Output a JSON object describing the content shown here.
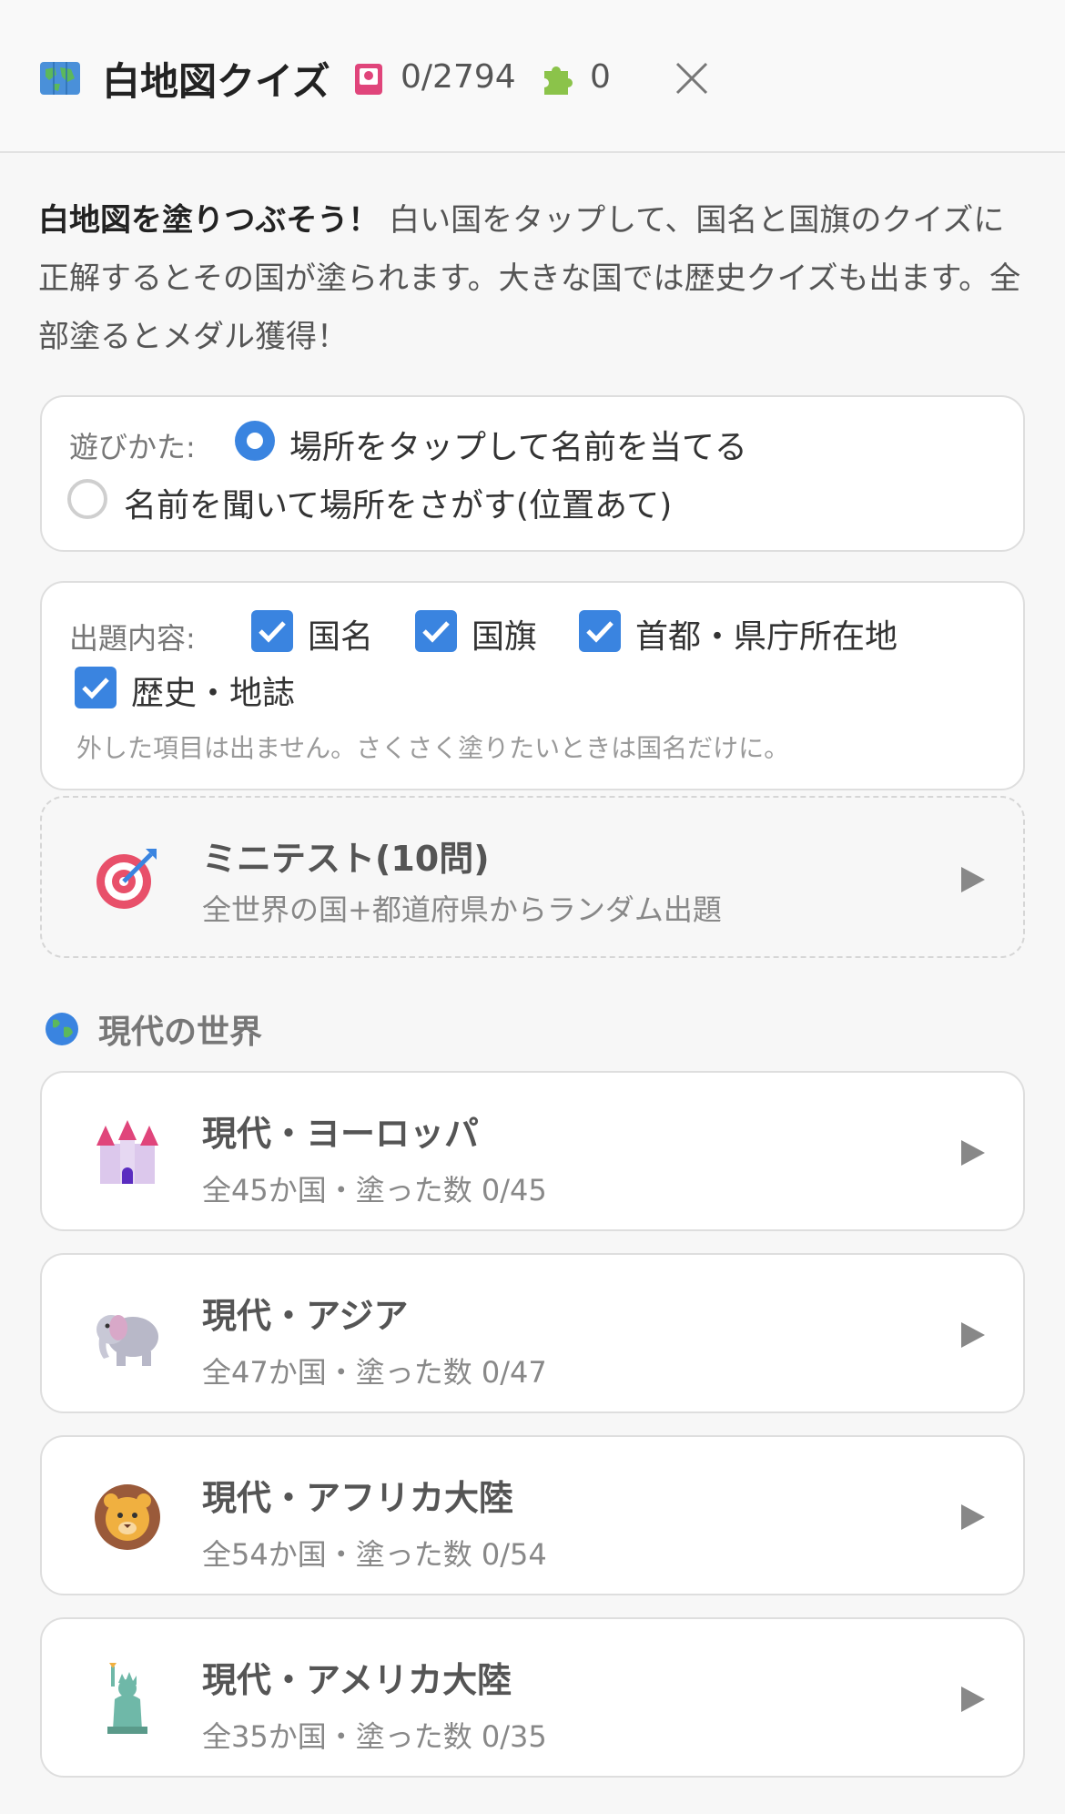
{
  "header": {
    "title": "白地図クイズ",
    "count": "0/2794",
    "pieces": "0"
  },
  "intro": {
    "lead": "白地図を塗りつぶそう！",
    "body": "白い国をタップして、国名と国旗のクイズに正解するとその国が塗られます。大きな国では歴史クイズも出ます。全部塗るとメダル獲得！"
  },
  "play": {
    "label": "遊びかた:",
    "options": [
      {
        "label": "場所をタップして名前を当てる",
        "selected": true
      },
      {
        "label": "名前を聞いて場所をさがす(位置あて)",
        "selected": false
      }
    ]
  },
  "content": {
    "label": "出題内容:",
    "options": [
      {
        "label": "国名",
        "checked": true
      },
      {
        "label": "国旗",
        "checked": true
      },
      {
        "label": "首都・県庁所在地",
        "checked": true
      },
      {
        "label": "歴史・地誌",
        "checked": true
      }
    ],
    "note": "外した項目は出ません。さくさく塗りたいときは国名だけに。"
  },
  "minitest": {
    "title": "ミニテスト(10問)",
    "subtitle": "全世界の国+都道府県からランダム出題",
    "icon": "target-icon"
  },
  "section": {
    "title": "現代の世界",
    "icon": "globe-icon"
  },
  "regions": [
    {
      "title": "現代・ヨーロッパ",
      "subtitle": "全45か国・塗った数 0/45",
      "icon": "castle-icon"
    },
    {
      "title": "現代・アジア",
      "subtitle": "全47か国・塗った数 0/47",
      "icon": "elephant-icon"
    },
    {
      "title": "現代・アフリカ大陸",
      "subtitle": "全54か国・塗った数 0/54",
      "icon": "lion-icon"
    },
    {
      "title": "現代・アメリカ大陸",
      "subtitle": "全35か国・塗った数 0/35",
      "icon": "statue-of-liberty-icon"
    }
  ],
  "colors": {
    "accent": "#3a84e0",
    "background": "#f7f7f7"
  }
}
